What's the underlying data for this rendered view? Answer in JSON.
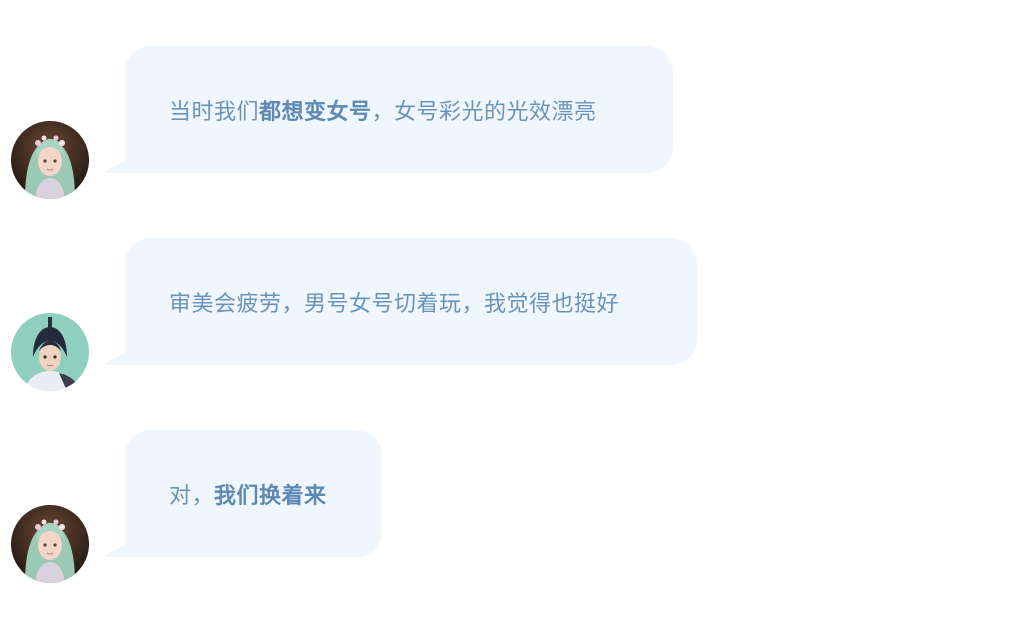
{
  "messages": [
    {
      "avatar": "female-character-avatar",
      "parts": [
        {
          "text": "当时我们",
          "bold": false
        },
        {
          "text": "都想变女号",
          "bold": true
        },
        {
          "text": "，女号彩光的光效漂亮",
          "bold": false
        }
      ]
    },
    {
      "avatar": "male-character-avatar",
      "parts": [
        {
          "text": "审美会疲劳，男号女号切着玩，我觉得也挺好",
          "bold": false
        }
      ]
    },
    {
      "avatar": "female-character-avatar",
      "parts": [
        {
          "text": "对，",
          "bold": false
        },
        {
          "text": "我们换着来",
          "bold": true
        }
      ]
    }
  ],
  "colors": {
    "bubble_bg": "#eff6fd",
    "text": "#6a93bb",
    "text_bold": "#5d89b4"
  }
}
